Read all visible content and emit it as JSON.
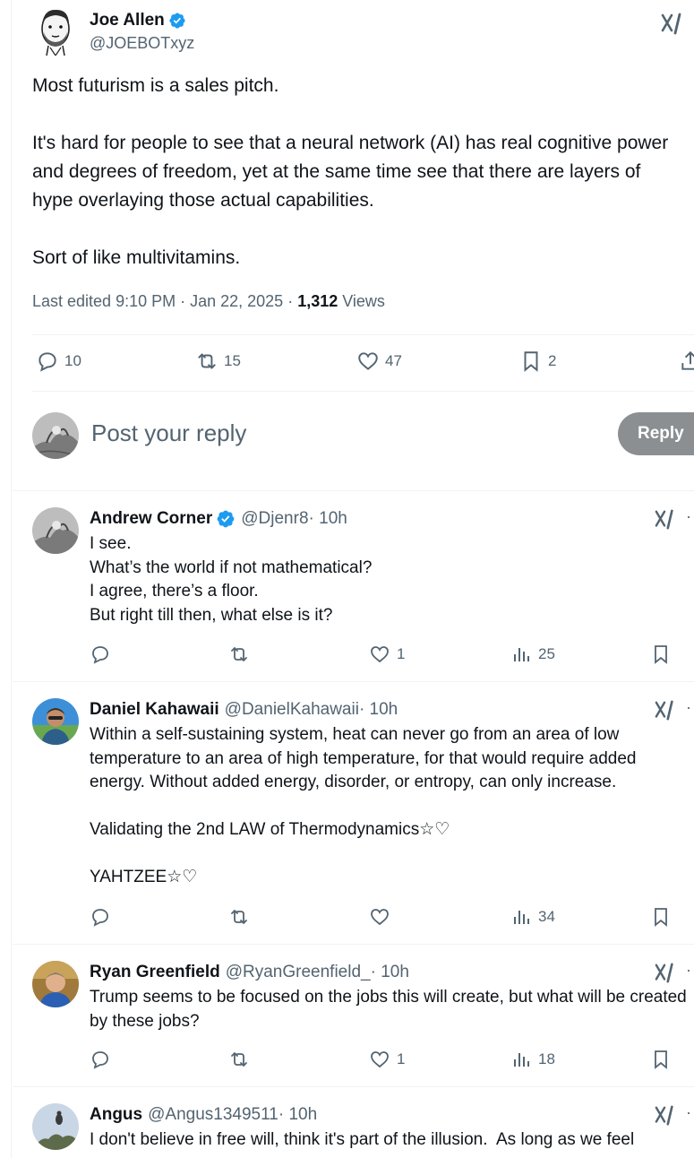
{
  "post": {
    "author_name": "Joe Allen",
    "author_handle": "@JOEBOTxyz",
    "text": "Most futurism is a sales pitch.\n\nIt's hard for people to see that a neural network (AI) has real cognitive power and degrees of freedom, yet at the same time see that there are layers of hype overlaying those actual capabilities.\n\nSort of like multivitamins.",
    "meta_prefix": "Last edited 9:10 PM · Jan 22, 2025 · ",
    "views_count": "1,312",
    "views_label": " Views",
    "stats": {
      "replies": "10",
      "reposts": "15",
      "likes": "47",
      "bookmarks": "2"
    }
  },
  "composer": {
    "placeholder": "Post your reply",
    "button_label": "Reply"
  },
  "replies": [
    {
      "name": "Andrew Corner",
      "verified": true,
      "handle": "@Djenr8",
      "time": " · 10h",
      "text": "I see.\nWhat’s the world if not mathematical?\nI agree, there’s a floor.\nBut right till then, what else is it?",
      "likes": "1",
      "views": "25"
    },
    {
      "name": "Daniel Kahawaii",
      "verified": false,
      "handle": "@DanielKahawaii",
      "time": " · 10h",
      "text": "Within a self-sustaining system, heat can never go from an area of low temperature to an area of high temperature, for that would require added energy. Without added energy, disorder, or entropy, can only increase.\n\nValidating the 2nd LAW of Thermodynamics☆♡\n\nYAHTZEE☆♡",
      "likes": "",
      "views": "34"
    },
    {
      "name": "Ryan Greenfield",
      "verified": false,
      "handle": "@RyanGreenfield_",
      "time": " · 10h",
      "text": "Trump seems to be focused on the jobs this will create, but what will be created by these jobs?",
      "likes": "1",
      "views": "18"
    },
    {
      "name": "Angus",
      "verified": false,
      "handle": "@Angus1349511",
      "time": " · 10h",
      "text": "I don't believe in free will, think it's part of the illusion.  As long as we feel",
      "likes": "",
      "views": ""
    }
  ],
  "colors": {
    "text_primary": "#0f1419",
    "text_secondary": "#536471",
    "verified_blue": "#1d9bf0",
    "divider": "#eff3f4",
    "reply_button_bg": "#8b8f92"
  },
  "icons": [
    "verified-badge-icon",
    "grok-icon",
    "reply-icon",
    "repost-icon",
    "like-icon",
    "bookmark-icon",
    "share-icon",
    "views-icon",
    "more-icon"
  ]
}
